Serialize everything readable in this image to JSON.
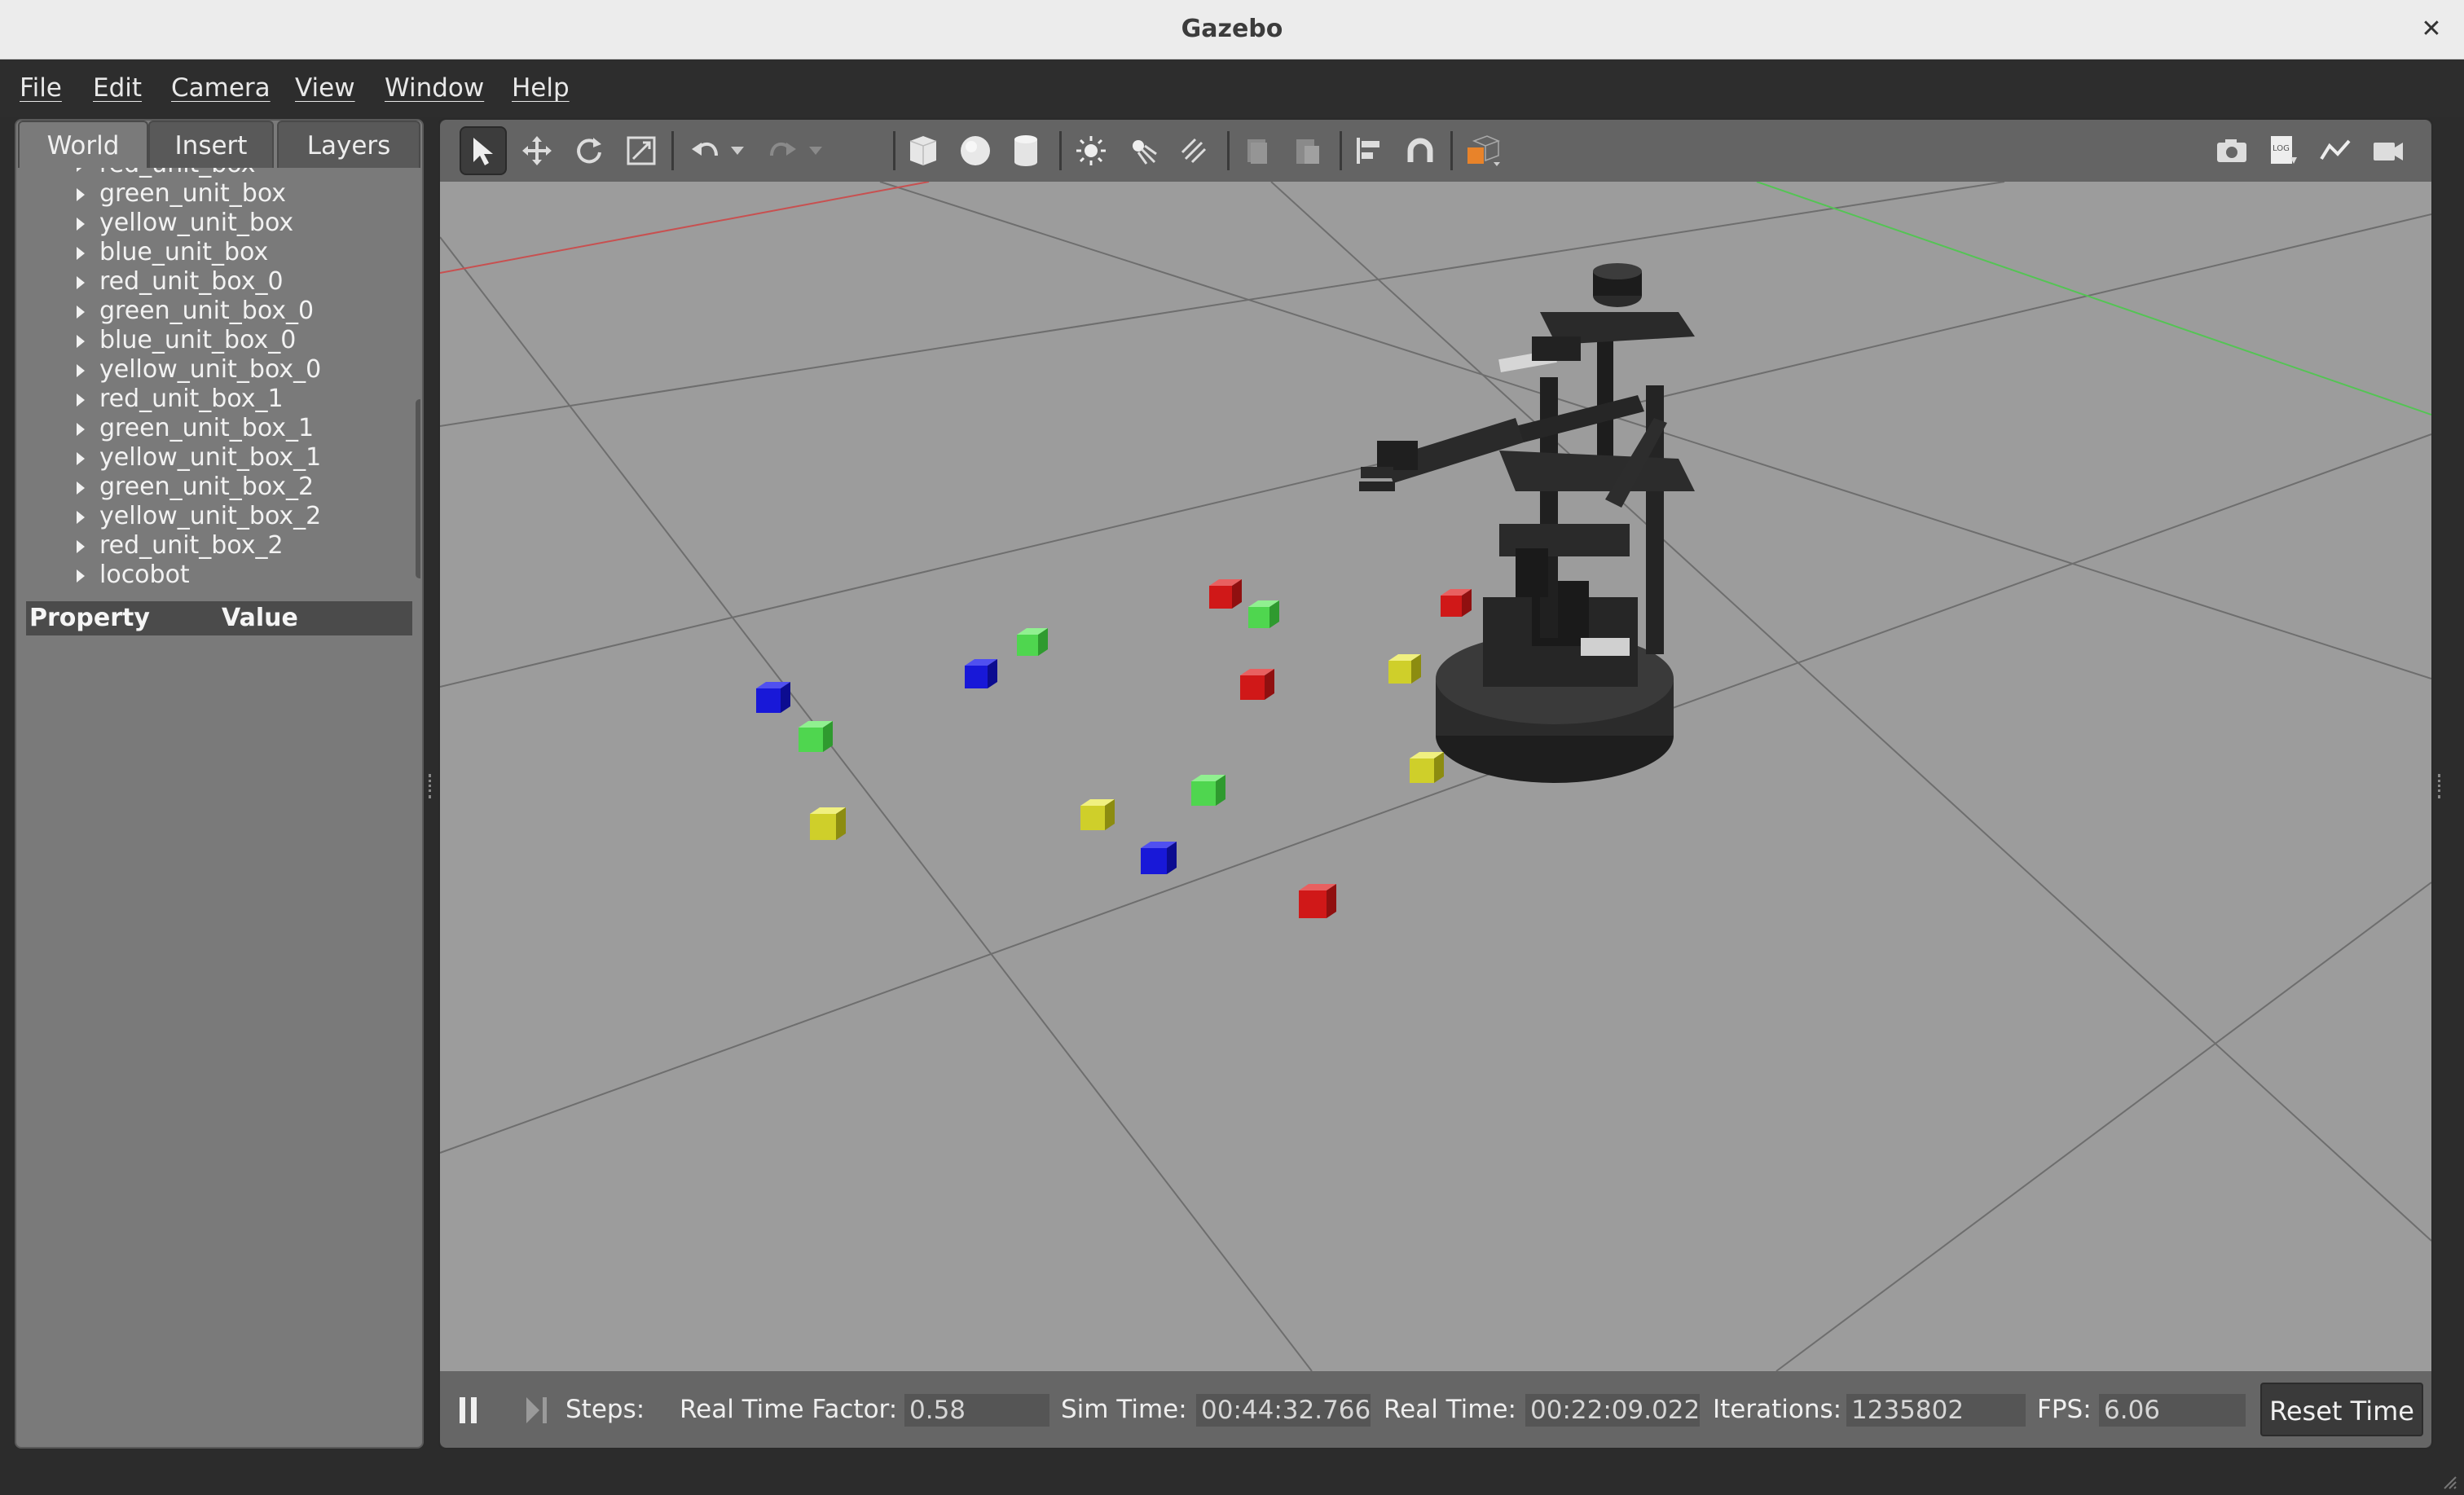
{
  "window": {
    "title": "Gazebo",
    "close_glyph": "✕"
  },
  "menu": [
    "File",
    "Edit",
    "Camera",
    "View",
    "Window",
    "Help"
  ],
  "left_panel": {
    "tabs": [
      "World",
      "Insert",
      "Layers"
    ],
    "active_tab": "World",
    "tree_items": [
      "red_unit_box",
      "green_unit_box",
      "yellow_unit_box",
      "blue_unit_box",
      "red_unit_box_0",
      "green_unit_box_0",
      "blue_unit_box_0",
      "yellow_unit_box_0",
      "red_unit_box_1",
      "green_unit_box_1",
      "yellow_unit_box_1",
      "green_unit_box_2",
      "yellow_unit_box_2",
      "red_unit_box_2",
      "locobot"
    ],
    "property_header": {
      "property": "Property",
      "value": "Value"
    }
  },
  "toolbar": {
    "left_tools": [
      "select-arrow-icon",
      "translate-icon",
      "rotate-icon",
      "scale-icon",
      "undo-icon",
      "undo-dropdown-icon",
      "redo-icon",
      "redo-dropdown-icon",
      "box-shape-icon",
      "sphere-shape-icon",
      "cylinder-shape-icon",
      "point-light-icon",
      "spot-light-icon",
      "directional-light-icon",
      "copy-icon",
      "paste-icon",
      "align-icon",
      "snap-magnet-icon",
      "view-angle-icon"
    ],
    "right_tools": [
      "screenshot-camera-icon",
      "log-icon",
      "plot-icon",
      "video-record-icon"
    ]
  },
  "status": {
    "steps_label": "Steps:",
    "rtf_label": "Real Time Factor:",
    "rtf_value": "0.58",
    "sim_time_label": "Sim Time:",
    "sim_time_value": "00:44:32.766",
    "real_time_label": "Real Time:",
    "real_time_value": "00:22:09.022",
    "iterations_label": "Iterations:",
    "iterations_value": "1235802",
    "fps_label": "FPS:",
    "fps_value": "6.06",
    "reset_label": "Reset Time"
  },
  "colors": {
    "red_box": "#d01818",
    "green_box": "#4fd64f",
    "yellow_box": "#cfcf2a",
    "blue_box": "#1818d8",
    "ground": "#9b9b9b"
  }
}
